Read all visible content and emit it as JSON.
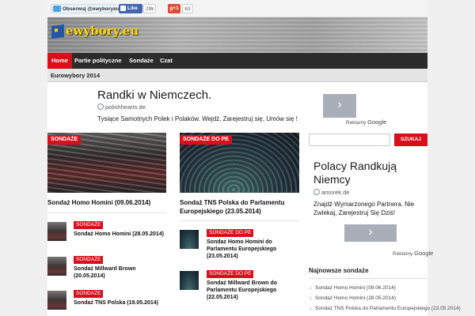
{
  "social": {
    "twitter_label": "Obserwuj @ewyboryeu",
    "facebook_label": "Like",
    "facebook_count": "29k",
    "gplus_label": "g+1",
    "gplus_count": "63"
  },
  "header": {
    "logo_text": "ewybory.eu"
  },
  "nav": {
    "items": [
      "Home",
      "Partie polityczne",
      "Sondaże",
      "Czat"
    ],
    "active_index": 0,
    "sub_item": "Eurowybory 2014"
  },
  "ad_top": {
    "title": "Randki w Niemczech.",
    "url": "polishhearts.de",
    "desc": "Tysiące Samotnych Polek i Polaków. Wejdź, Zarejestruj się, Umów się !",
    "arrow": "›",
    "reklamy": "Reklamy",
    "google": "Google"
  },
  "column_a": {
    "label": "SONDAŻE",
    "headline": "Sondaż Homo Homini (09.06.2014)",
    "items": [
      {
        "label": "SONDAŻE",
        "title": "Sondaż Homo Homini (28.05.2014)"
      },
      {
        "label": "SONDAŻE",
        "title": "Sondaż Millward Brown (20.05.2014)"
      },
      {
        "label": "SONDAŻE",
        "title": "Sondaż TNS Polska (19.05.2014)"
      }
    ]
  },
  "column_b": {
    "label": "SONDAŻE DO PE",
    "headline": "Sondaż TNS Polska do Parlamentu Europejskiego (23.05.2014)",
    "items": [
      {
        "label": "SONDAŻE DO PE",
        "title": "Sondaż Homo Homini do Parlamentu Europejskiego (23.05.2014)"
      },
      {
        "label": "SONDAŻE DO PE",
        "title": "Sondaż Millward Brown do Parlamentu Europejskiego (22.05.2014)"
      }
    ]
  },
  "sidebar": {
    "search_placeholder": "",
    "search_button": "SZUKAJ",
    "ad": {
      "title": "Polacy Randkują Niemcy",
      "url": "amorek.de",
      "desc": "Znajdź Wymarzonego Partnera. Nie Zwlekaj, Zarejestruj Się Dziś!",
      "arrow": "›",
      "reklamy": "Reklamy",
      "google": "Google"
    },
    "latest_heading": "Najnowsze sondaże",
    "latest": [
      "Sondaż Homo Homini (09.06.2014)",
      "Sondaż Homo Homini (28.05.2014)",
      "Sondaż TNS Polska do Parlamentu Europejskiego (23.05.2014)"
    ]
  },
  "colors": {
    "accent": "#d8101c",
    "nav_bg": "#2b2b2b",
    "logo": "#ffd400"
  }
}
